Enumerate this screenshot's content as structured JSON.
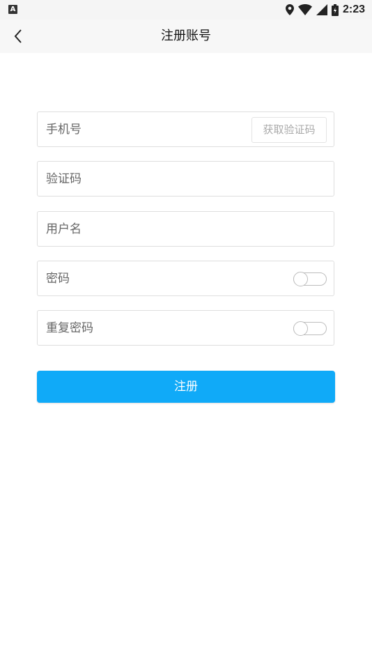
{
  "status_bar": {
    "indicator": "A",
    "time": "2:23",
    "icons": [
      "location-icon",
      "wifi-icon",
      "signal-icon",
      "battery-icon"
    ]
  },
  "app_bar": {
    "title": "注册账号",
    "back_icon": "back-chevron-icon"
  },
  "form": {
    "phone": {
      "placeholder": "手机号",
      "value": ""
    },
    "get_code_label": "获取验证码",
    "verify_code": {
      "placeholder": "验证码",
      "value": ""
    },
    "username": {
      "placeholder": "用户名",
      "value": ""
    },
    "password": {
      "placeholder": "密码",
      "value": "",
      "visible": false
    },
    "confirm_password": {
      "placeholder": "重复密码",
      "value": "",
      "visible": false
    },
    "submit_label": "注册"
  },
  "colors": {
    "accent": "#10aaf8",
    "appbar_bg": "#f7f7f7",
    "border": "#dedede"
  }
}
